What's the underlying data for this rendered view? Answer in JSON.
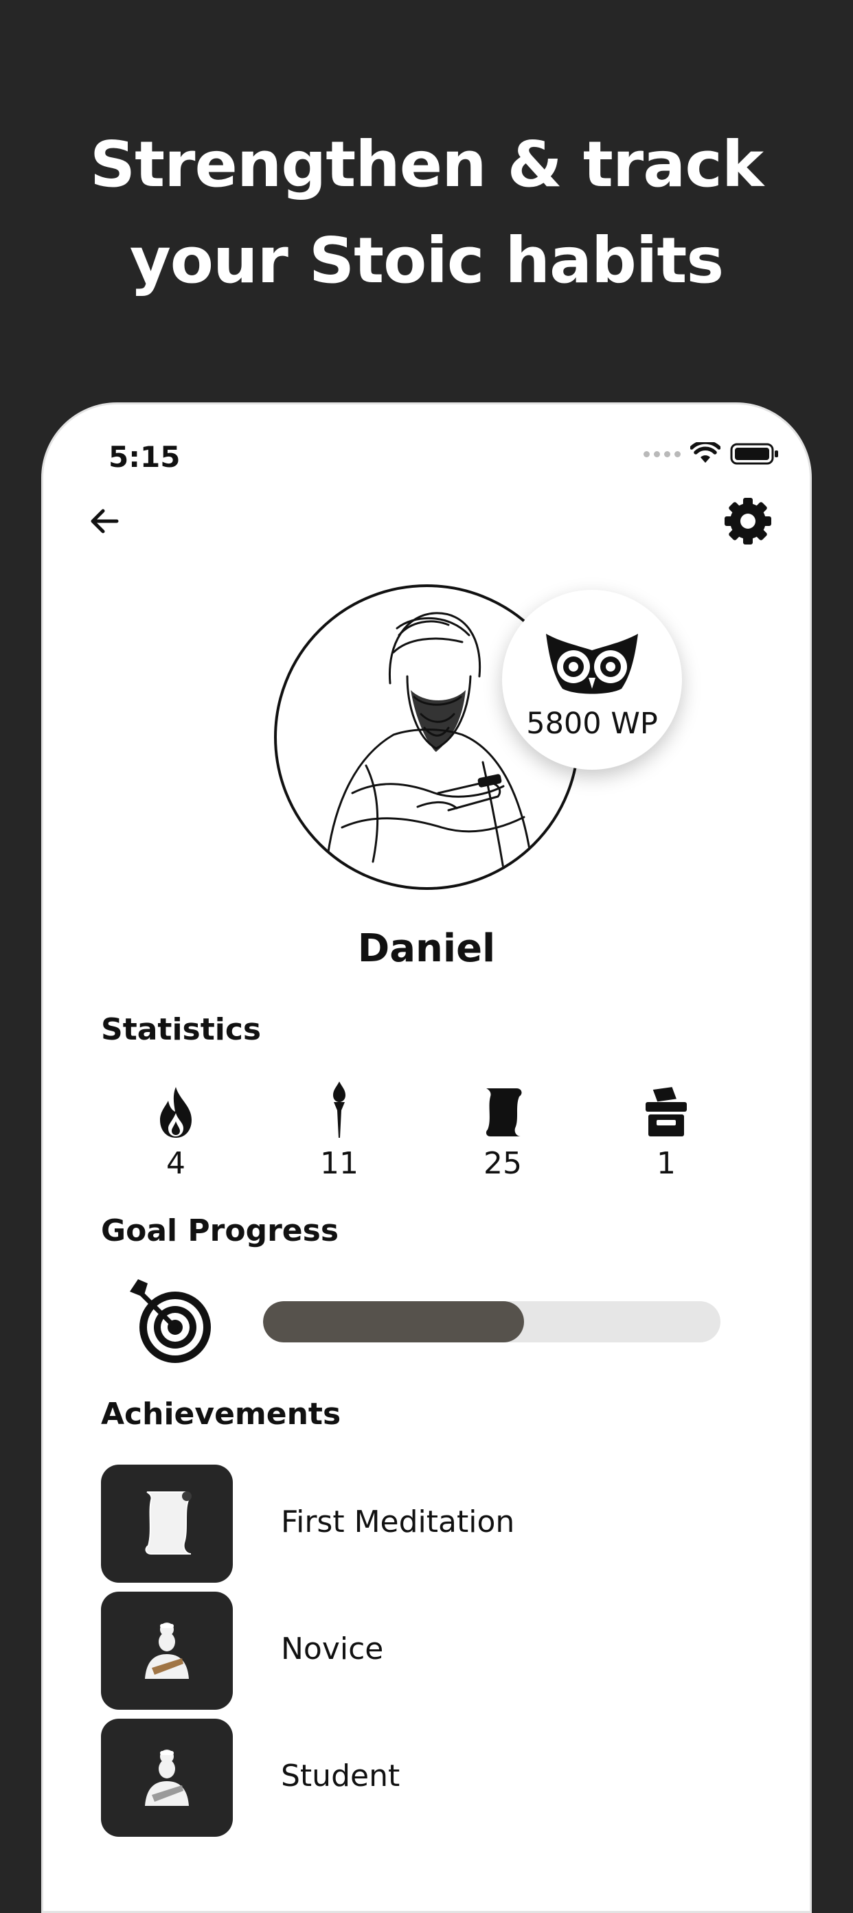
{
  "promo": {
    "headline_line1": "Strengthen & track",
    "headline_line2": "your Stoic habits"
  },
  "status_bar": {
    "time": "5:15"
  },
  "profile": {
    "name": "Daniel",
    "wisdom_points": "5800 WP",
    "avatar_icon": "stoic-philosopher-with-phone-illustration",
    "badge_icon": "owl-icon"
  },
  "statistics": {
    "title": "Statistics",
    "items": [
      {
        "icon": "flame-icon",
        "value": "4"
      },
      {
        "icon": "torch-icon",
        "value": "11"
      },
      {
        "icon": "scroll-icon",
        "value": "25"
      },
      {
        "icon": "chest-icon",
        "value": "1"
      }
    ]
  },
  "goal_progress": {
    "title": "Goal Progress",
    "icon": "target-icon",
    "progress_fraction": 0.57
  },
  "achievements": {
    "title": "Achievements",
    "items": [
      {
        "icon": "scroll-icon",
        "label": "First Meditation"
      },
      {
        "icon": "stoic-bust-icon",
        "label": "Novice"
      },
      {
        "icon": "stoic-bust-icon",
        "label": "Student"
      }
    ]
  },
  "colors": {
    "background": "#262626",
    "progress_fill": "#56524c",
    "progress_track": "#e6e6e6",
    "tile": "#262626"
  }
}
